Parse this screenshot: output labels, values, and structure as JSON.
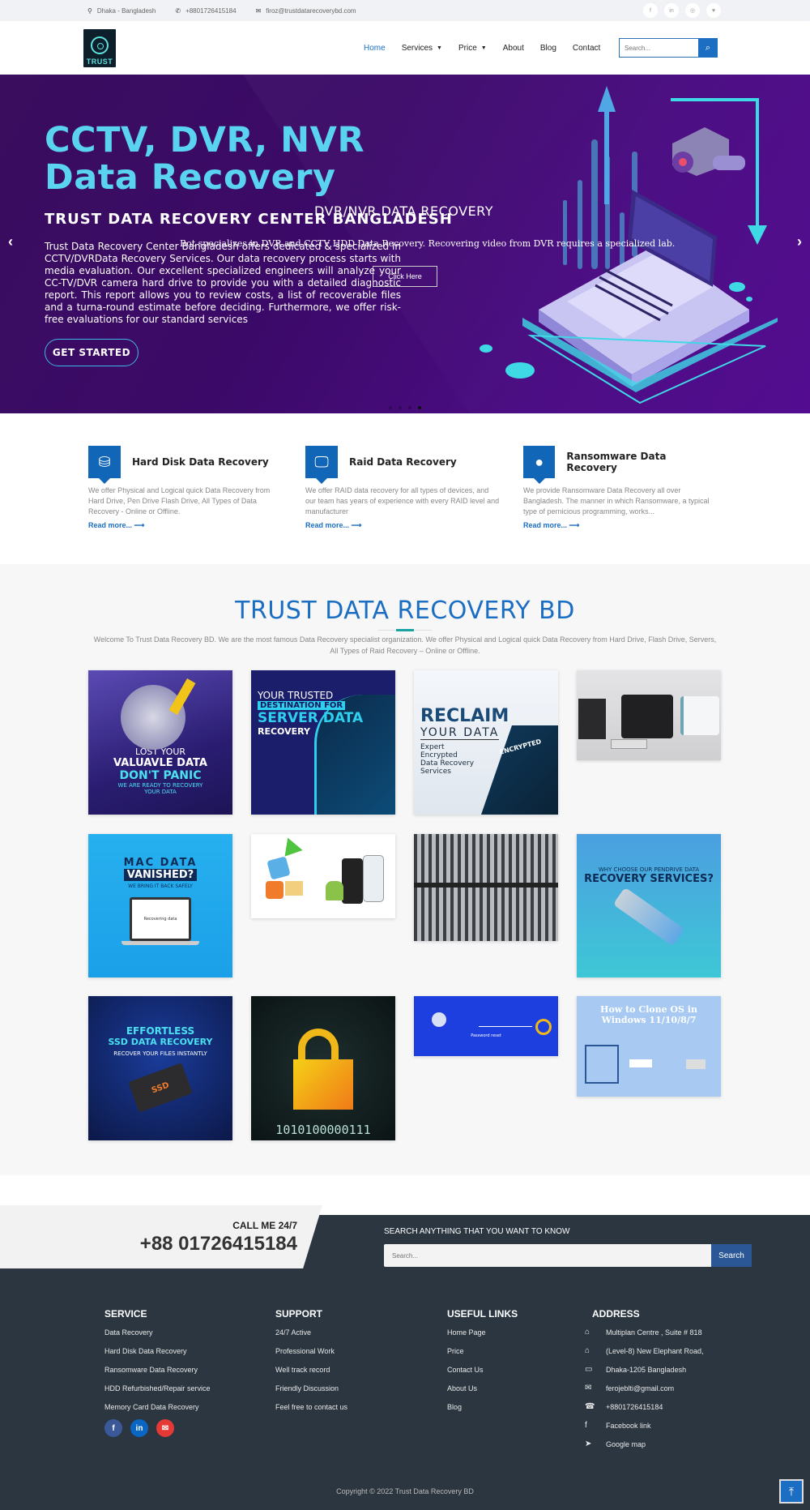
{
  "topbar": {
    "location": "Dhaka - Bangladesh",
    "phone": "+8801726415184",
    "email": "firoz@trustdatarecoverybd.com",
    "social": [
      {
        "name": "facebook",
        "glyph": "f"
      },
      {
        "name": "linkedin",
        "glyph": "in"
      },
      {
        "name": "instagram",
        "glyph": "◎"
      },
      {
        "name": "twitter",
        "glyph": "♥"
      }
    ]
  },
  "header": {
    "logo_text": "TRUST",
    "nav": [
      {
        "label": "Home",
        "active": true,
        "dropdown": false
      },
      {
        "label": "Services",
        "active": false,
        "dropdown": true
      },
      {
        "label": "Price",
        "active": false,
        "dropdown": true
      },
      {
        "label": "About",
        "active": false,
        "dropdown": false
      },
      {
        "label": "Blog",
        "active": false,
        "dropdown": false
      },
      {
        "label": "Contact",
        "active": false,
        "dropdown": false
      }
    ],
    "search_placeholder": "Search...",
    "search_icon": "🔍"
  },
  "hero": {
    "title_line1": "CCTV, DVR, NVR",
    "title_line2": "Data Recovery",
    "subtitle": "TRUST DATA RECOVERY CENTER BANGLADESH",
    "body": "Trust Data Recovery Center Bangladesh offers dedicated & specialized in CCTV/DVRData Recovery Services. Our data recovery process starts with media evaluation. Our excellent specialized engineers will analyze your CC-TV/DVR camera hard drive to provide you with a detailed diagnostic report. This report allows you to review costs, a list of recoverable files and a turna-round estimate before deciding. Furthermore, we offer risk-free evaluations for our standard services",
    "cta": "GET STARTED",
    "overlay_title": "DVR/NVR DATA RECOVERY",
    "overlay_body": "Bot specializes in DVR and CCTV HDD Data Recovery. Recovering video from DVR requires a specialized lab.",
    "overlay_button": "Click Here",
    "prev": "‹",
    "next": "›",
    "slides": 4,
    "active_slide": 4
  },
  "services": [
    {
      "title": "Hard Disk Data Recovery",
      "icon": "hard-disk-icon",
      "glyph": "⛁",
      "text": "We offer Physical and Logical quick Data Recovery from Hard Drive, Pen Drive Flash Drive, All Types of Data Recovery - Online or Offline.",
      "link": "Read more... ⟶"
    },
    {
      "title": "Raid Data Recovery",
      "icon": "monitor-icon",
      "glyph": "🖵",
      "text": "We offer RAID data recovery for all types of devices, and our team has years of experience with every RAID level and manufacturer",
      "link": "Read more... ⟶"
    },
    {
      "title": "Ransomware Data Recovery",
      "icon": "drupal-drop-icon",
      "glyph": "●",
      "text": "We provide Ransomware Data Recovery all over Bangladesh. The manner in which Ransomware, a typical type of pernicious programming, works...",
      "link": "Read more... ⟶"
    }
  ],
  "gallery": {
    "title": "TRUST DATA RECOVERY BD",
    "description": "Welcome To Trust Data Recovery BD. We are the most famous Data Recovery specialist organization. We offer Physical and Logical quick Data Recovery from Hard Drive, Flash Drive, Servers, All Types of Raid Recovery – Online or Offline.",
    "items": [
      {
        "name": "lost-data-poster",
        "lines": [
          "LOST YOUR",
          "VALUAVLE DATA",
          "DON'T PANIC",
          "WE ARE READY TO RECOVERY YOUR DATA"
        ]
      },
      {
        "name": "server-data-poster",
        "lines": [
          "YOUR TRUSTED",
          "DESTINATION FOR",
          "SERVER DATA",
          "RECOVERY"
        ]
      },
      {
        "name": "encrypted-data-poster",
        "lines": [
          "RECLAIM",
          "YOUR DATA",
          "Expert Encrypted Data Recovery Services",
          "ENCRYPTED"
        ]
      },
      {
        "name": "nas-devices-photo",
        "lines": []
      },
      {
        "name": "mac-data-poster",
        "lines": [
          "MAC DATA",
          "VANISHED?",
          "WE BRING IT BACK SAFELY",
          "Recovering data"
        ]
      },
      {
        "name": "phone-data-image",
        "lines": []
      },
      {
        "name": "server-rack-photo",
        "lines": []
      },
      {
        "name": "pendrive-poster",
        "lines": [
          "WHY CHOOSE OUR PENDRIVE DATA",
          "RECOVERY SERVICES?"
        ]
      },
      {
        "name": "ssd-recovery-poster",
        "lines": [
          "EFFORTLESS",
          "SSD DATA RECOVERY",
          "RECOVER YOUR FILES INSTANTLY",
          "SSD"
        ]
      },
      {
        "name": "padlock-binary-image",
        "lines": [
          "1010100000111"
        ]
      },
      {
        "name": "password-reset-image",
        "lines": [
          "Password reset"
        ]
      },
      {
        "name": "clone-os-image",
        "lines": [
          "How to Clone OS in Windows 11/10/8/7"
        ]
      }
    ]
  },
  "cta": {
    "call_label": "CALL ME 24/7",
    "phone": "+88 01726415184",
    "search_label": "SEARCH ANYTHING THAT YOU WANT TO KNOW",
    "search_placeholder": "Search...",
    "search_button": "Search"
  },
  "footer": {
    "service": {
      "heading": "SERVICE",
      "items": [
        "Data Recovery",
        "Hard Disk Data Recovery",
        "Ransomware Data Recovery",
        "HDD Refurbished/Repair service",
        "Memory Card Data Recovery"
      ]
    },
    "support": {
      "heading": "SUPPORT",
      "items": [
        "24/7 Active",
        "Professional Work",
        "Well track record",
        "Friendly Discussion",
        "Feel free to contact us"
      ]
    },
    "useful": {
      "heading": "USEFUL LINKS",
      "items": [
        "Home Page",
        "Price",
        "Contact Us",
        "About Us",
        "Blog"
      ]
    },
    "address": {
      "heading": "ADDRESS",
      "items": [
        {
          "icon": "home-icon",
          "glyph": "⌂",
          "text": "Multiplan Centre , Suite # 818"
        },
        {
          "icon": "home-icon",
          "glyph": "⌂",
          "text": "(Level-8) New Elephant Road,"
        },
        {
          "icon": "map-icon",
          "glyph": "▭",
          "text": "Dhaka-1205 Bangladesh"
        },
        {
          "icon": "mail-bulk-icon",
          "glyph": "✉",
          "text": "ferojeblti@gmail.com"
        },
        {
          "icon": "phone-square-icon",
          "glyph": "☎",
          "text": "+8801726415184"
        },
        {
          "icon": "facebook-icon",
          "glyph": "f",
          "text": "Facebook link"
        },
        {
          "icon": "location-arrow-icon",
          "glyph": "➤",
          "text": "Google map"
        }
      ]
    },
    "social": [
      {
        "name": "facebook",
        "glyph": "f",
        "color": "#3b5998"
      },
      {
        "name": "linkedin",
        "glyph": "in",
        "color": "#0a66c2"
      },
      {
        "name": "email",
        "glyph": "✉",
        "color": "#e53935"
      }
    ],
    "copyright": "Copyright © 2022 Trust Data Recovery BD",
    "to_top": "⤒"
  },
  "colors": {
    "brand_blue": "#1b6ec2",
    "hero_cyan": "#5ad3f0",
    "footer_bg": "#2b3641"
  }
}
